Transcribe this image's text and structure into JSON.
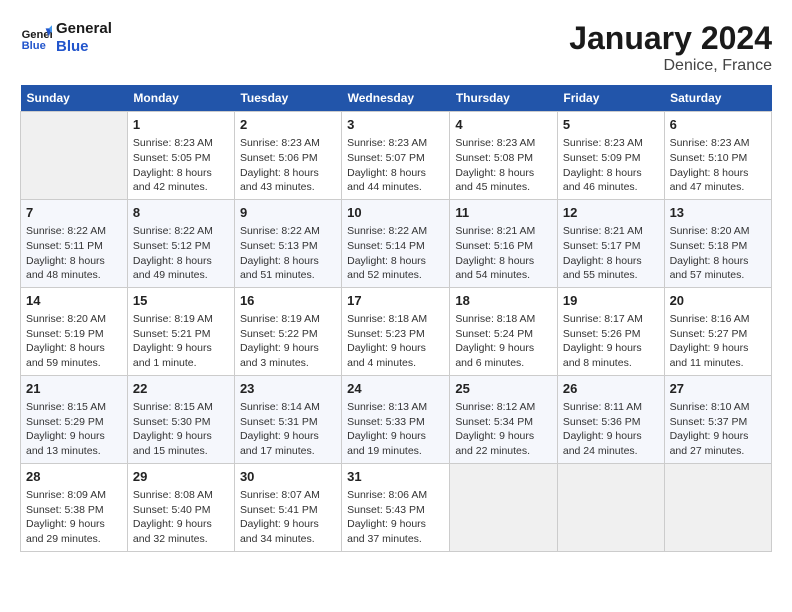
{
  "header": {
    "logo_line1": "General",
    "logo_line2": "Blue",
    "title": "January 2024",
    "subtitle": "Denice, France"
  },
  "days_of_week": [
    "Sunday",
    "Monday",
    "Tuesday",
    "Wednesday",
    "Thursday",
    "Friday",
    "Saturday"
  ],
  "weeks": [
    [
      {
        "num": "",
        "info": ""
      },
      {
        "num": "1",
        "info": "Sunrise: 8:23 AM\nSunset: 5:05 PM\nDaylight: 8 hours\nand 42 minutes."
      },
      {
        "num": "2",
        "info": "Sunrise: 8:23 AM\nSunset: 5:06 PM\nDaylight: 8 hours\nand 43 minutes."
      },
      {
        "num": "3",
        "info": "Sunrise: 8:23 AM\nSunset: 5:07 PM\nDaylight: 8 hours\nand 44 minutes."
      },
      {
        "num": "4",
        "info": "Sunrise: 8:23 AM\nSunset: 5:08 PM\nDaylight: 8 hours\nand 45 minutes."
      },
      {
        "num": "5",
        "info": "Sunrise: 8:23 AM\nSunset: 5:09 PM\nDaylight: 8 hours\nand 46 minutes."
      },
      {
        "num": "6",
        "info": "Sunrise: 8:23 AM\nSunset: 5:10 PM\nDaylight: 8 hours\nand 47 minutes."
      }
    ],
    [
      {
        "num": "7",
        "info": "Sunrise: 8:22 AM\nSunset: 5:11 PM\nDaylight: 8 hours\nand 48 minutes."
      },
      {
        "num": "8",
        "info": "Sunrise: 8:22 AM\nSunset: 5:12 PM\nDaylight: 8 hours\nand 49 minutes."
      },
      {
        "num": "9",
        "info": "Sunrise: 8:22 AM\nSunset: 5:13 PM\nDaylight: 8 hours\nand 51 minutes."
      },
      {
        "num": "10",
        "info": "Sunrise: 8:22 AM\nSunset: 5:14 PM\nDaylight: 8 hours\nand 52 minutes."
      },
      {
        "num": "11",
        "info": "Sunrise: 8:21 AM\nSunset: 5:16 PM\nDaylight: 8 hours\nand 54 minutes."
      },
      {
        "num": "12",
        "info": "Sunrise: 8:21 AM\nSunset: 5:17 PM\nDaylight: 8 hours\nand 55 minutes."
      },
      {
        "num": "13",
        "info": "Sunrise: 8:20 AM\nSunset: 5:18 PM\nDaylight: 8 hours\nand 57 minutes."
      }
    ],
    [
      {
        "num": "14",
        "info": "Sunrise: 8:20 AM\nSunset: 5:19 PM\nDaylight: 8 hours\nand 59 minutes."
      },
      {
        "num": "15",
        "info": "Sunrise: 8:19 AM\nSunset: 5:21 PM\nDaylight: 9 hours\nand 1 minute."
      },
      {
        "num": "16",
        "info": "Sunrise: 8:19 AM\nSunset: 5:22 PM\nDaylight: 9 hours\nand 3 minutes."
      },
      {
        "num": "17",
        "info": "Sunrise: 8:18 AM\nSunset: 5:23 PM\nDaylight: 9 hours\nand 4 minutes."
      },
      {
        "num": "18",
        "info": "Sunrise: 8:18 AM\nSunset: 5:24 PM\nDaylight: 9 hours\nand 6 minutes."
      },
      {
        "num": "19",
        "info": "Sunrise: 8:17 AM\nSunset: 5:26 PM\nDaylight: 9 hours\nand 8 minutes."
      },
      {
        "num": "20",
        "info": "Sunrise: 8:16 AM\nSunset: 5:27 PM\nDaylight: 9 hours\nand 11 minutes."
      }
    ],
    [
      {
        "num": "21",
        "info": "Sunrise: 8:15 AM\nSunset: 5:29 PM\nDaylight: 9 hours\nand 13 minutes."
      },
      {
        "num": "22",
        "info": "Sunrise: 8:15 AM\nSunset: 5:30 PM\nDaylight: 9 hours\nand 15 minutes."
      },
      {
        "num": "23",
        "info": "Sunrise: 8:14 AM\nSunset: 5:31 PM\nDaylight: 9 hours\nand 17 minutes."
      },
      {
        "num": "24",
        "info": "Sunrise: 8:13 AM\nSunset: 5:33 PM\nDaylight: 9 hours\nand 19 minutes."
      },
      {
        "num": "25",
        "info": "Sunrise: 8:12 AM\nSunset: 5:34 PM\nDaylight: 9 hours\nand 22 minutes."
      },
      {
        "num": "26",
        "info": "Sunrise: 8:11 AM\nSunset: 5:36 PM\nDaylight: 9 hours\nand 24 minutes."
      },
      {
        "num": "27",
        "info": "Sunrise: 8:10 AM\nSunset: 5:37 PM\nDaylight: 9 hours\nand 27 minutes."
      }
    ],
    [
      {
        "num": "28",
        "info": "Sunrise: 8:09 AM\nSunset: 5:38 PM\nDaylight: 9 hours\nand 29 minutes."
      },
      {
        "num": "29",
        "info": "Sunrise: 8:08 AM\nSunset: 5:40 PM\nDaylight: 9 hours\nand 32 minutes."
      },
      {
        "num": "30",
        "info": "Sunrise: 8:07 AM\nSunset: 5:41 PM\nDaylight: 9 hours\nand 34 minutes."
      },
      {
        "num": "31",
        "info": "Sunrise: 8:06 AM\nSunset: 5:43 PM\nDaylight: 9 hours\nand 37 minutes."
      },
      {
        "num": "",
        "info": ""
      },
      {
        "num": "",
        "info": ""
      },
      {
        "num": "",
        "info": ""
      }
    ]
  ]
}
